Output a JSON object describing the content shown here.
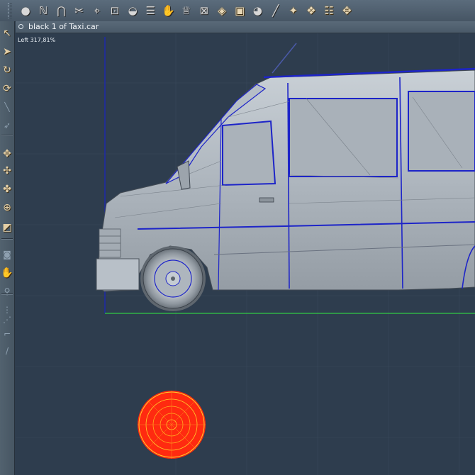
{
  "document": {
    "title": "black 1 of Taxi.car"
  },
  "viewport": {
    "label": "Left 317,81%"
  },
  "toolbar": {
    "tools": [
      {
        "icon": "sphere-icon",
        "glyph": "●",
        "metal": true
      },
      {
        "icon": "spline-icon",
        "glyph": "ℕ",
        "metal": true
      },
      {
        "icon": "magnet-icon",
        "glyph": "⋂",
        "metal": true
      },
      {
        "icon": "scissors-icon",
        "glyph": "✂",
        "metal": true
      },
      {
        "icon": "weld-icon",
        "glyph": "⌖",
        "metal": true
      },
      {
        "icon": "bounding-box-icon",
        "glyph": "⊡",
        "metal": true
      },
      {
        "icon": "dome-icon",
        "glyph": "◒",
        "metal": true
      },
      {
        "icon": "lathe-icon",
        "glyph": "☰",
        "metal": true
      },
      {
        "icon": "hand-grab-icon",
        "glyph": "✋",
        "metal": true
      },
      {
        "icon": "goblet-icon",
        "glyph": "♕",
        "metal": true
      },
      {
        "icon": "wireframe-box-icon",
        "glyph": "⊠",
        "metal": true
      },
      {
        "icon": "shaded-box-icon",
        "glyph": "◈",
        "metal": false
      },
      {
        "icon": "bag-icon",
        "glyph": "▣",
        "metal": false
      },
      {
        "icon": "render-sphere-icon",
        "glyph": "◕",
        "metal": true
      },
      {
        "icon": "wand-icon",
        "glyph": "╱",
        "metal": true
      },
      {
        "icon": "boolean-icon",
        "glyph": "✦",
        "metal": false
      },
      {
        "icon": "group-icon",
        "glyph": "❖",
        "metal": false
      },
      {
        "icon": "properties-icon",
        "glyph": "☷",
        "metal": false
      },
      {
        "icon": "figure-icon",
        "glyph": "✥",
        "metal": false
      }
    ]
  },
  "sidebar": {
    "tools": [
      {
        "icon": "select-arrow-icon",
        "glyph": "↖",
        "dim": false
      },
      {
        "icon": "move-arrow-icon",
        "glyph": "➤",
        "dim": false
      },
      {
        "icon": "rotate-icon",
        "glyph": "↻",
        "dim": false
      },
      {
        "icon": "twist-icon",
        "glyph": "⟳",
        "dim": false
      },
      {
        "icon": "pen-icon",
        "glyph": "╲",
        "dim": true
      },
      {
        "icon": "lasso-icon",
        "glyph": "➶",
        "dim": true
      },
      {
        "icon": "move-xy-icon",
        "glyph": "✥",
        "dim": false
      },
      {
        "icon": "move-xz-icon",
        "glyph": "✣",
        "dim": false
      },
      {
        "icon": "move-yz-icon",
        "glyph": "✤",
        "dim": false
      },
      {
        "icon": "scale-icon",
        "glyph": "⊕",
        "dim": false
      },
      {
        "icon": "box-view-icon",
        "glyph": "◩",
        "dim": false
      },
      {
        "icon": "camera-icon",
        "glyph": "◙",
        "dim": true
      },
      {
        "icon": "pan-hand-icon",
        "glyph": "✋",
        "dim": false
      },
      {
        "icon": "zoom-icon",
        "glyph": "⚲",
        "dim": true
      },
      {
        "icon": "dotted-line-icon",
        "glyph": "⋮",
        "dim": true
      },
      {
        "icon": "ruler-icon",
        "glyph": "⋰",
        "dim": true
      },
      {
        "icon": "crop-icon",
        "glyph": "⌐",
        "dim": true
      },
      {
        "icon": "knife-icon",
        "glyph": "/",
        "dim": true
      }
    ]
  },
  "colors": {
    "background": "#2e3d4e",
    "model": "#b2bac2",
    "wire_select": "#1d24c8",
    "ground_line": "#33cc44",
    "wheel_marker": "#ff2a10"
  }
}
